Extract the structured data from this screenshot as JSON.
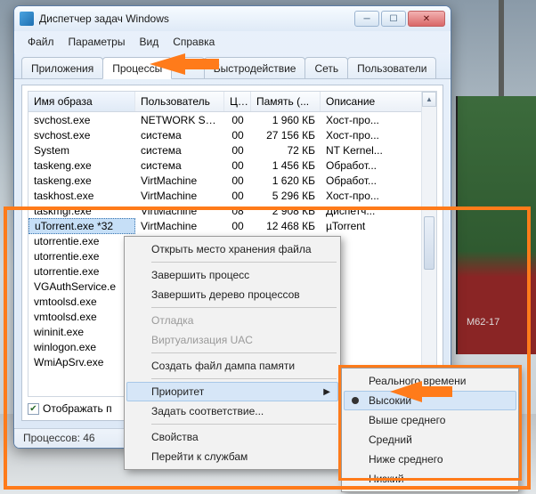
{
  "bg": {
    "train_marking": "М62-17"
  },
  "window": {
    "title": "Диспетчер задач Windows",
    "menus": [
      "Файл",
      "Параметры",
      "Вид",
      "Справка"
    ],
    "tabs": {
      "items": [
        "Приложения",
        "Процессы",
        "бы",
        "Быстродействие",
        "Сеть",
        "Пользователи"
      ],
      "active_index": 1
    },
    "columns": [
      "Имя образа",
      "Пользователь",
      "ЦП",
      "Память (...",
      "Описание"
    ],
    "rows": [
      {
        "name": "svchost.exe",
        "user": "NETWORK SE...",
        "cpu": "00",
        "mem": "1 960 КБ",
        "desc": "Хост-про..."
      },
      {
        "name": "svchost.exe",
        "user": "система",
        "cpu": "00",
        "mem": "27 156 КБ",
        "desc": "Хост-про..."
      },
      {
        "name": "System",
        "user": "система",
        "cpu": "00",
        "mem": "72 КБ",
        "desc": "NT Kernel..."
      },
      {
        "name": "taskeng.exe",
        "user": "система",
        "cpu": "00",
        "mem": "1 456 КБ",
        "desc": "Обработ..."
      },
      {
        "name": "taskeng.exe",
        "user": "VirtMachine",
        "cpu": "00",
        "mem": "1 620 КБ",
        "desc": "Обработ..."
      },
      {
        "name": "taskhost.exe",
        "user": "VirtMachine",
        "cpu": "00",
        "mem": "5 296 КБ",
        "desc": "Хост-про..."
      },
      {
        "name": "taskmgr.exe",
        "user": "VirtMachine",
        "cpu": "08",
        "mem": "2 908 КБ",
        "desc": "Диспетч..."
      },
      {
        "name": "uTorrent.exe *32",
        "user": "VirtMachine",
        "cpu": "00",
        "mem": "12 468 КБ",
        "desc": "µTorrent",
        "selected": true
      },
      {
        "name": "utorrentie.exe",
        "user": "",
        "cpu": "",
        "mem": "",
        "desc": ""
      },
      {
        "name": "utorrentie.exe",
        "user": "",
        "cpu": "",
        "mem": "",
        "desc": ""
      },
      {
        "name": "utorrentie.exe",
        "user": "",
        "cpu": "",
        "mem": "",
        "desc": ""
      },
      {
        "name": "VGAuthService.e",
        "user": "",
        "cpu": "",
        "mem": "",
        "desc": ""
      },
      {
        "name": "vmtoolsd.exe",
        "user": "",
        "cpu": "",
        "mem": "",
        "desc": ""
      },
      {
        "name": "vmtoolsd.exe",
        "user": "",
        "cpu": "",
        "mem": "",
        "desc": ""
      },
      {
        "name": "wininit.exe",
        "user": "",
        "cpu": "",
        "mem": "",
        "desc": ""
      },
      {
        "name": "winlogon.exe",
        "user": "",
        "cpu": "",
        "mem": "",
        "desc": ""
      },
      {
        "name": "WmiApSrv.exe",
        "user": "",
        "cpu": "",
        "mem": "",
        "desc": ""
      }
    ],
    "checkbox_label": "Отображать п",
    "status": "Процессов: 46"
  },
  "ctx1": {
    "items": [
      {
        "label": "Открыть место хранения файла"
      },
      {
        "sep": true
      },
      {
        "label": "Завершить процесс"
      },
      {
        "label": "Завершить дерево процессов"
      },
      {
        "sep": true
      },
      {
        "label": "Отладка",
        "disabled": true
      },
      {
        "label": "Виртуализация UAC",
        "disabled": true
      },
      {
        "sep": true
      },
      {
        "label": "Создать файл дампа памяти"
      },
      {
        "sep": true
      },
      {
        "label": "Приоритет",
        "submenu": true,
        "highlight": true
      },
      {
        "label": "Задать соответствие..."
      },
      {
        "sep": true
      },
      {
        "label": "Свойства"
      },
      {
        "label": "Перейти к службам"
      }
    ]
  },
  "ctx2": {
    "items": [
      {
        "label": "Реального времени"
      },
      {
        "label": "Высокий",
        "highlight": true,
        "radio": true
      },
      {
        "label": "Выше среднего"
      },
      {
        "label": "Средний"
      },
      {
        "label": "Ниже среднего"
      },
      {
        "label": "Низкий"
      }
    ]
  }
}
